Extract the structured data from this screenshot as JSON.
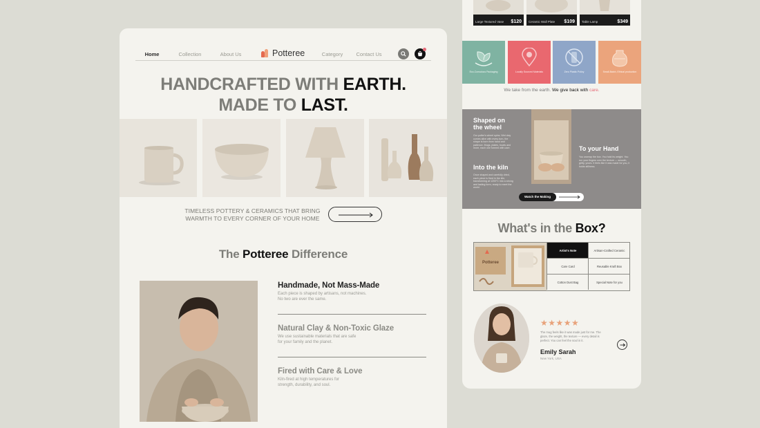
{
  "nav": {
    "items": [
      "Home",
      "Collection",
      "About Us",
      "Category",
      "Contact Us"
    ],
    "brand": "Potteree"
  },
  "hero": {
    "line1_muted": "HANDCRAFTED WITH ",
    "line1_bold": "EARTH.",
    "line2_muted": "MADE TO ",
    "line2_bold": "LAST."
  },
  "tagline": {
    "line1": "TIMELESS POTTERY & CERAMICS THAT BRING",
    "line2": "WARMTH TO EVERY CORNER OF YOUR HOME"
  },
  "difference": {
    "title_muted1": "The ",
    "title_bold": "Potteree",
    "title_muted2": " Difference",
    "features": [
      {
        "title": "Handmade, Not Mass-Made",
        "line1": "Each piece is shaped by artisans, not machines.",
        "line2": "No two are ever the same."
      },
      {
        "title": "Natural Clay & Non-Toxic Glaze",
        "line1": "We use sustainable materials that are safe",
        "line2": "for your family and the planet."
      },
      {
        "title": "Fired with Care & Love",
        "line1": "Kiln-fired at high temperatures for",
        "line2": "strength, durability, and soul."
      }
    ]
  },
  "products": [
    {
      "name": "Large Textured Vase",
      "price": "$120"
    },
    {
      "name": "Ceramic Wall Plate",
      "price": "$109"
    },
    {
      "name": "Table Lamp",
      "price": "$349"
    }
  ],
  "values": {
    "tiles": [
      {
        "caption": "Eco-Conscious Packaging",
        "color": "#7fb3a2"
      },
      {
        "caption": "Locally Sourced Materials",
        "color": "#e9686f"
      },
      {
        "caption": "Zero Plastic Policy",
        "color": "#8fa6c8"
      },
      {
        "caption": "Small-Batch, Ethical production",
        "color": "#eba47c"
      }
    ],
    "line_muted": "We take from the earth. ",
    "line_bold": "We give back with ",
    "line_accent": "care."
  },
  "process": {
    "step1_title": "Shaped on the wheel",
    "step1_text": "Our potter's wheel spins. Wet clay comes alive with every turn, the shape is born from hand and patience. Mugs, plates, bowls and more, each one formed with care.",
    "step2_title": "Into the kiln",
    "step2_text": "Once shaped and carefully dried, each piece is fired in the kiln, transforming at 1200°C into a strong and lasting form, ready to meet the world.",
    "step3_title": "To your Hand",
    "step3_text": "You unwrap the box. You hold its weight. You run your fingers over the texture — smooth, gritty, yours. It feels like it was made for you, it holds stillness.",
    "watch_label": "Watch the Making"
  },
  "box": {
    "title_muted": "What's in the ",
    "title_bold": "Box?",
    "brand_on_box": "Potteree",
    "cells": [
      "Artist's Note",
      "Artisan-Crafted Ceramic",
      "Care Card",
      "Reusable Kraft Box",
      "Cotton Dust Bag",
      "Special Note for you"
    ]
  },
  "review": {
    "stars": "★★★★★",
    "text": "The mug feels like it was made just for me. The glaze, the weight, the texture — every detail is perfect. You can feel the soul in it.",
    "name": "Emily Sarah",
    "location": "New York, USA"
  },
  "colors": {
    "accent": "#e46a78",
    "card_bg": "#f4f3ee",
    "page_bg": "#dcdcd4",
    "process_bg": "#8e8b8a",
    "star": "#e8a27a"
  },
  "icons": [
    "search-icon",
    "cart-icon",
    "arrow-right-icon",
    "leaf-icon",
    "location-pin-icon",
    "no-plastic-icon",
    "pot-icon"
  ]
}
